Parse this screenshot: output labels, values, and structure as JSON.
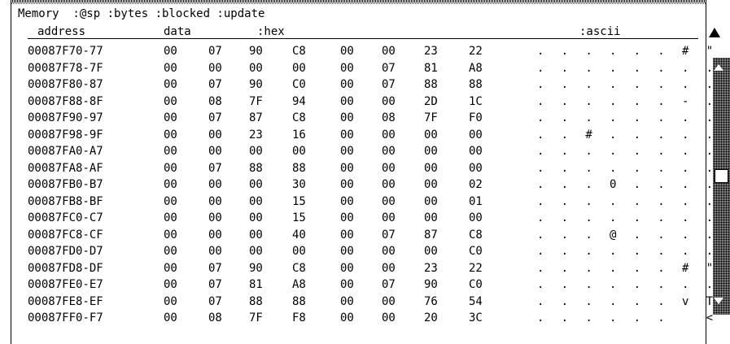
{
  "panel": {
    "title": "Memory  :@sp :bytes :blocked :update",
    "columns": {
      "address": "address",
      "data": "data",
      "hex": ":hex",
      "ascii": ":ascii"
    }
  },
  "rows": [
    {
      "address": "00087F70-77",
      "bytes": [
        "00",
        "07",
        "90",
        "C8",
        "00",
        "00",
        "23",
        "22"
      ],
      "ascii": ". . . . . . # \""
    },
    {
      "address": "00087F78-7F",
      "bytes": [
        "00",
        "00",
        "00",
        "00",
        "00",
        "07",
        "81",
        "A8"
      ],
      "ascii": ". . . . . . . ."
    },
    {
      "address": "00087F80-87",
      "bytes": [
        "00",
        "07",
        "90",
        "C0",
        "00",
        "07",
        "88",
        "88"
      ],
      "ascii": ". . . . . . . ."
    },
    {
      "address": "00087F88-8F",
      "bytes": [
        "00",
        "08",
        "7F",
        "94",
        "00",
        "00",
        "2D",
        "1C"
      ],
      "ascii": ". . . . . . - ."
    },
    {
      "address": "00087F90-97",
      "bytes": [
        "00",
        "07",
        "87",
        "C8",
        "00",
        "08",
        "7F",
        "F0"
      ],
      "ascii": ". . . . . . . ."
    },
    {
      "address": "00087F98-9F",
      "bytes": [
        "00",
        "00",
        "23",
        "16",
        "00",
        "00",
        "00",
        "00"
      ],
      "ascii": ". . # . . . . ."
    },
    {
      "address": "00087FA0-A7",
      "bytes": [
        "00",
        "00",
        "00",
        "00",
        "00",
        "00",
        "00",
        "00"
      ],
      "ascii": ". . . . . . . ."
    },
    {
      "address": "00087FA8-AF",
      "bytes": [
        "00",
        "07",
        "88",
        "88",
        "00",
        "00",
        "00",
        "00"
      ],
      "ascii": ". . . . . . . ."
    },
    {
      "address": "00087FB0-B7",
      "bytes": [
        "00",
        "00",
        "00",
        "30",
        "00",
        "00",
        "00",
        "02"
      ],
      "ascii": ". . . 0 . . . ."
    },
    {
      "address": "00087FB8-BF",
      "bytes": [
        "00",
        "00",
        "00",
        "15",
        "00",
        "00",
        "00",
        "01"
      ],
      "ascii": ". . . . . . . ."
    },
    {
      "address": "00087FC0-C7",
      "bytes": [
        "00",
        "00",
        "00",
        "15",
        "00",
        "00",
        "00",
        "00"
      ],
      "ascii": ". . . . . . . ."
    },
    {
      "address": "00087FC8-CF",
      "bytes": [
        "00",
        "00",
        "00",
        "40",
        "00",
        "07",
        "87",
        "C8"
      ],
      "ascii": ". . . @ . . . ."
    },
    {
      "address": "00087FD0-D7",
      "bytes": [
        "00",
        "00",
        "00",
        "00",
        "00",
        "00",
        "00",
        "C0"
      ],
      "ascii": ". . . . . . . ."
    },
    {
      "address": "00087FD8-DF",
      "bytes": [
        "00",
        "07",
        "90",
        "C8",
        "00",
        "00",
        "23",
        "22"
      ],
      "ascii": ". . . . . . # \""
    },
    {
      "address": "00087FE0-E7",
      "bytes": [
        "00",
        "07",
        "81",
        "A8",
        "00",
        "07",
        "90",
        "C0"
      ],
      "ascii": ". . . . . . . ."
    },
    {
      "address": "00087FE8-EF",
      "bytes": [
        "00",
        "07",
        "88",
        "88",
        "00",
        "00",
        "76",
        "54"
      ],
      "ascii": ". . . . . . v T"
    },
    {
      "address": "00087FF0-F7",
      "bytes": [
        "00",
        "08",
        "7F",
        "F8",
        "00",
        "00",
        "20",
        "3C"
      ],
      "ascii": ". . . . . .   <"
    }
  ]
}
